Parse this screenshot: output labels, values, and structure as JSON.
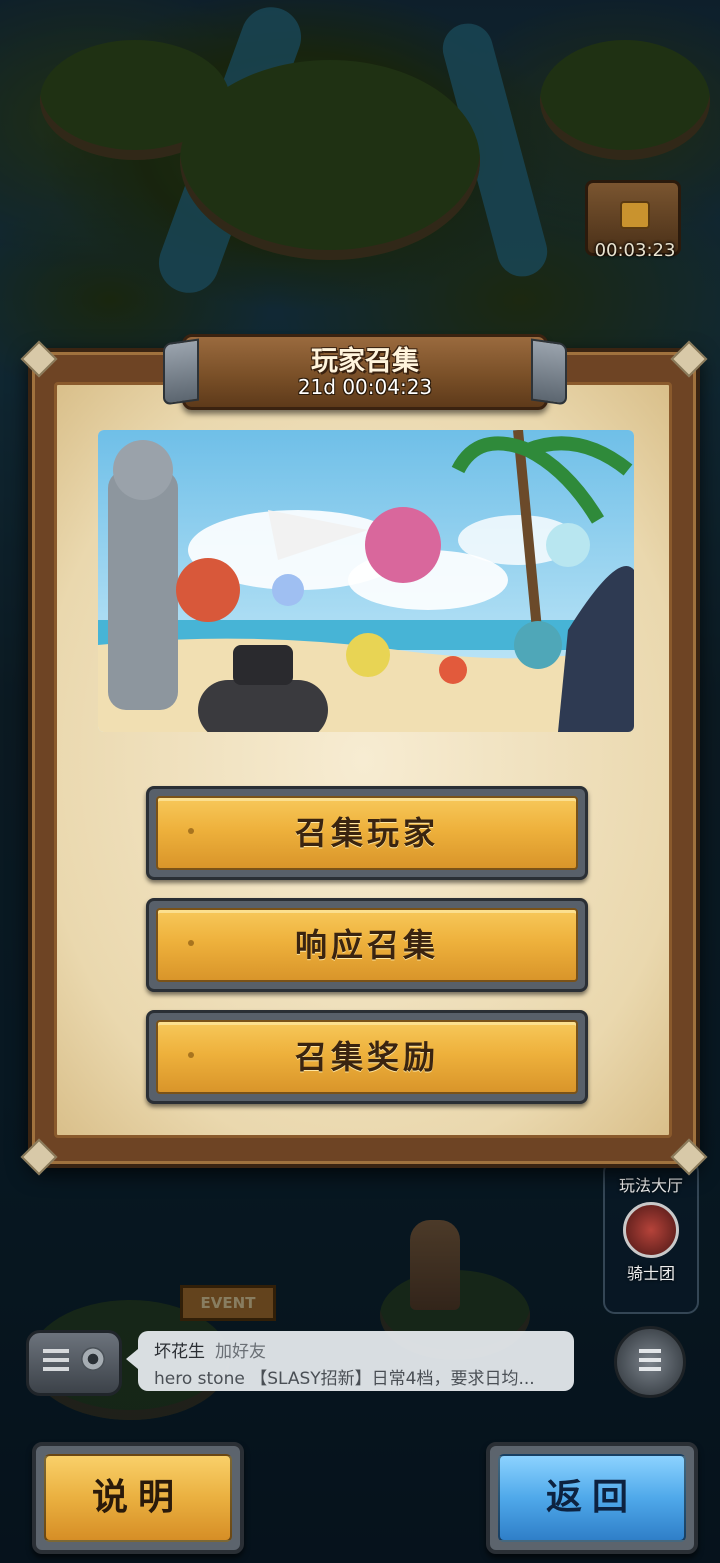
{
  "map": {
    "chest_timer": "00:03:23",
    "side_panel": {
      "hall_label": "玩法大厅",
      "guild_label": "骑士团"
    },
    "event_sign": "EVENT"
  },
  "dialog": {
    "title": "玩家召集",
    "timer": "21d 00:04:23",
    "buttons": [
      {
        "label": "召集玩家"
      },
      {
        "label": "响应召集"
      },
      {
        "label": "召集奖励"
      }
    ]
  },
  "chat": {
    "sender": "坏花生",
    "action": "加好友",
    "message": "hero stone 【SLASY招新】日常4档，要求日均..."
  },
  "bottom": {
    "help_label": "说明",
    "back_label": "返回"
  },
  "colors": {
    "button_gold": "#eeb13c",
    "button_blue": "#4fa9ea",
    "parchment": "#f7ecd2",
    "wood": "#6e4424"
  }
}
